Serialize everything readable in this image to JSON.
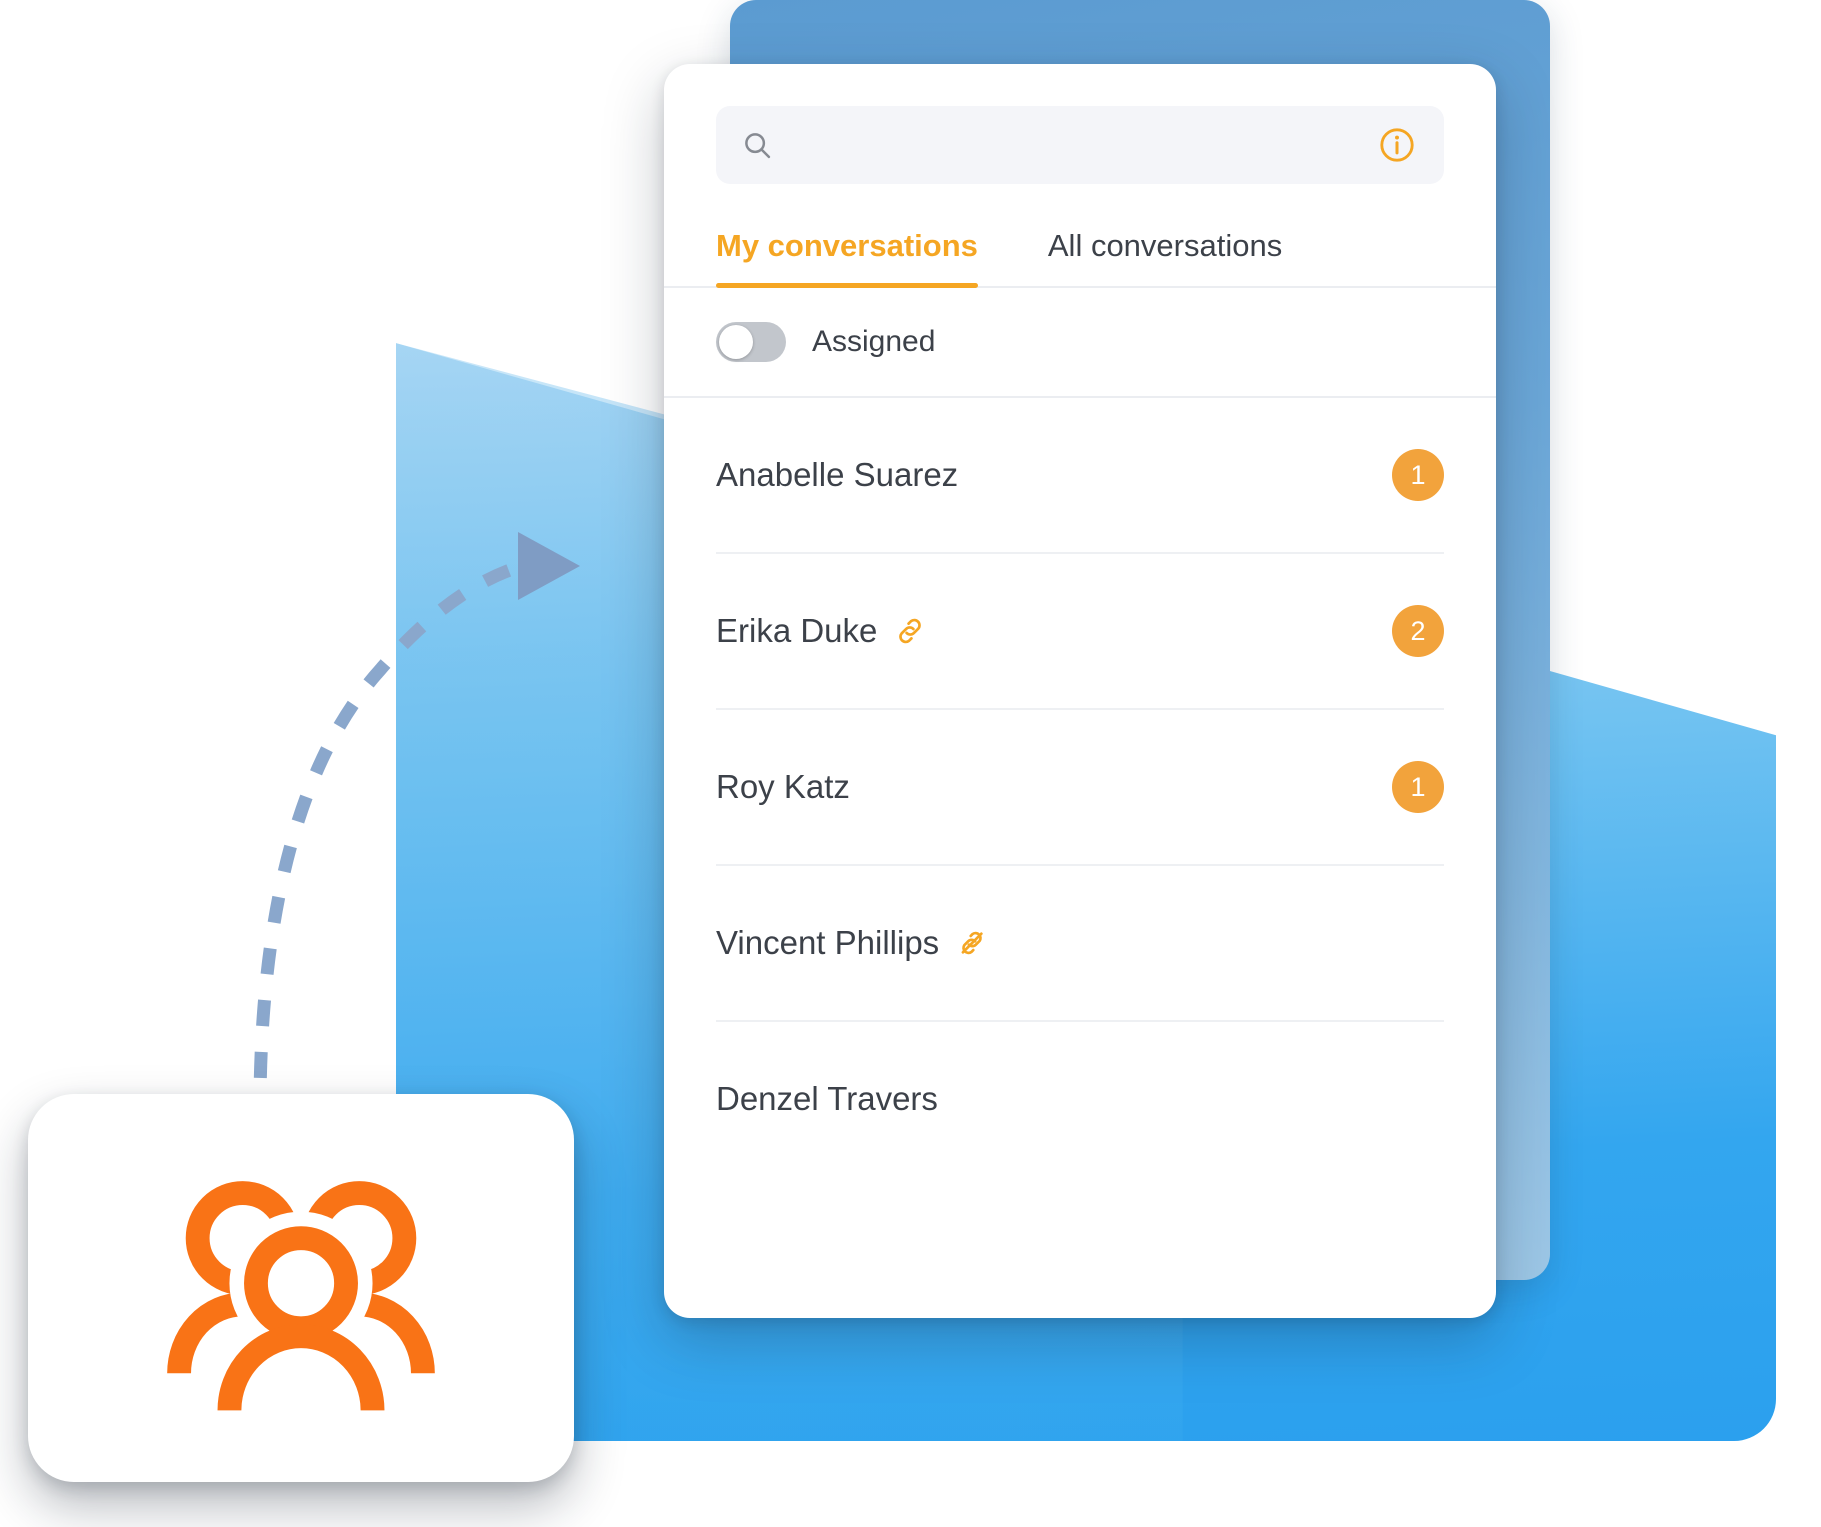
{
  "colors": {
    "accent_orange": "#F5A623",
    "badge_orange": "#F2A33C",
    "icon_orange": "#F97316",
    "text_dark": "#3C4149",
    "panel_blue": "#5B9BD1",
    "wedge_blue": "#33A6EF",
    "arrow_blue": "#8AA7CC",
    "card_white": "#FFFFFF",
    "search_bg": "#F4F5F9",
    "divider": "#EEF0F3",
    "toggle_off_track": "#C2C6CC"
  },
  "search": {
    "placeholder": "",
    "value": "",
    "search_icon": "search-icon",
    "info_icon": "info-circle-icon"
  },
  "tabs": [
    {
      "label": "My conversations",
      "active": true
    },
    {
      "label": "All conversations",
      "active": false
    }
  ],
  "filter": {
    "toggle_label": "Assigned",
    "toggle_state": "off"
  },
  "conversations": [
    {
      "name": "Anabelle Suarez",
      "badge": "1",
      "has_badge": true,
      "link_icon": "none"
    },
    {
      "name": "Erika Duke",
      "badge": "2",
      "has_badge": true,
      "link_icon": "chain-link-icon"
    },
    {
      "name": "Roy Katz",
      "badge": "1",
      "has_badge": true,
      "link_icon": "none"
    },
    {
      "name": "Vincent Phillips",
      "badge": "",
      "has_badge": false,
      "link_icon": "broken-link-icon"
    },
    {
      "name": "Denzel Travers",
      "badge": "",
      "has_badge": false,
      "link_icon": "none"
    }
  ],
  "decorations": {
    "arrow": "dashed-curved-arrow",
    "tile_icon": "group-people-icon"
  }
}
